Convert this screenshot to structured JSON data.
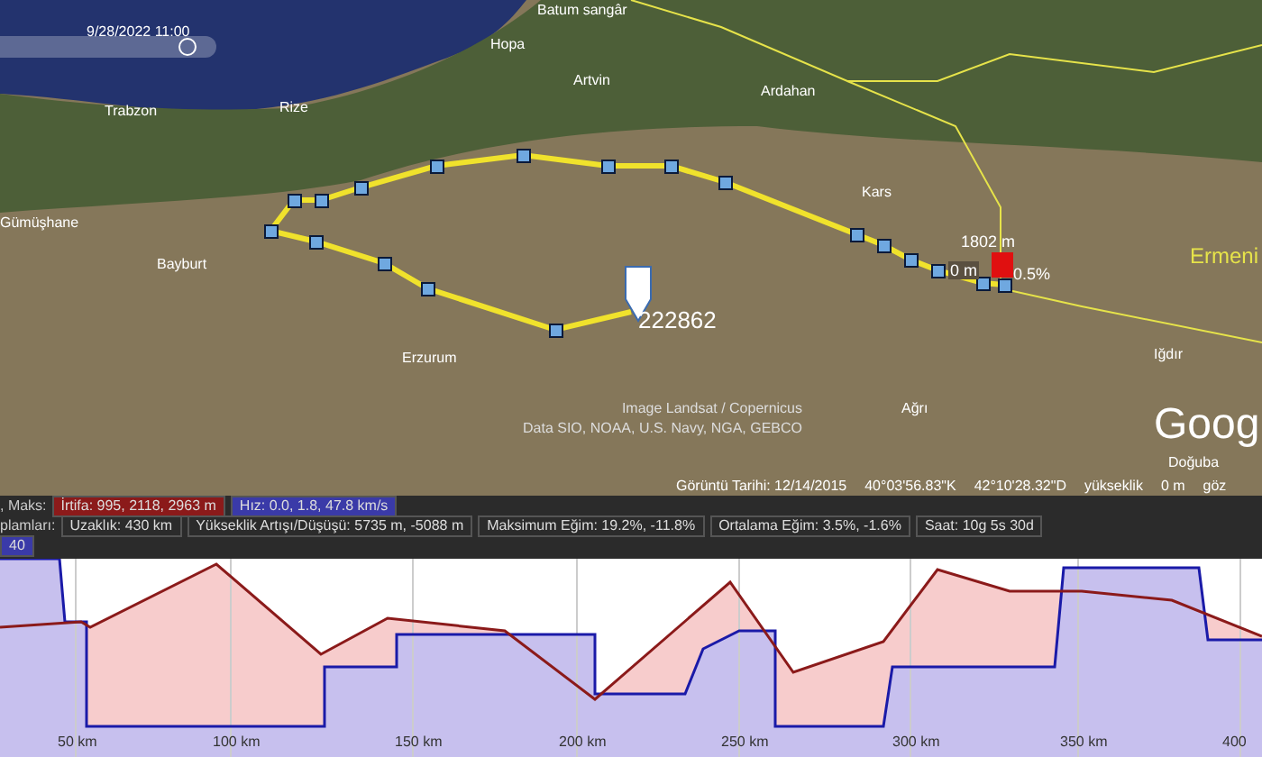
{
  "map": {
    "time_slider": {
      "label": "9/28/2022  11:00",
      "level": 0.9
    },
    "places": [
      {
        "name": "Batum sangâr"
      },
      {
        "name": "Hopa"
      },
      {
        "name": "Artvin"
      },
      {
        "name": "Trabzon"
      },
      {
        "name": "Rize"
      },
      {
        "name": "Ardahan"
      },
      {
        "name": "Kars"
      },
      {
        "name": "Gümüşhane"
      },
      {
        "name": "Bayburt"
      },
      {
        "name": "Erzurum"
      },
      {
        "name": "Iğdır"
      },
      {
        "name": "Ağrı"
      },
      {
        "name": "Doğuba"
      }
    ],
    "country": "Ermeni",
    "marker_label": "222862",
    "elevation_tag": "1802 m",
    "grade_tag": "0.5%",
    "small_tag": "0 m",
    "attribution": [
      "Image Landsat / Copernicus",
      "Data SIO, NOAA, U.S. Navy, NGA, GEBCO"
    ],
    "logo": "Goog",
    "status_bar": [
      "Görüntü Tarihi: 12/14/2015",
      "40°03'56.83\"K",
      "42°10'28.32\"D",
      "yükseklik",
      "0 m",
      "göz"
    ]
  },
  "stats": {
    "rows": [
      {
        "label": ", Maks:",
        "items": [
          {
            "text": "İrtifa: 995, 2118, 2963 m",
            "color": "#8b1a1a"
          },
          {
            "text": "Hız: 0.0, 1.8, 47.8 km/s",
            "color": "#3a3aa8"
          }
        ]
      },
      {
        "label": "plamları:",
        "items": [
          {
            "text": "Uzaklık: 430 km",
            "color": "#2b2b2b"
          },
          {
            "text": "Yükseklik Artışı/Düşüşü: 5735 m, -5088 m",
            "color": "#2b2b2b"
          },
          {
            "text": "Maksimum Eğim: 19.2%, -11.8%",
            "color": "#2b2b2b"
          },
          {
            "text": "Ortalama Eğim: 3.5%, -1.6%",
            "color": "#2b2b2b"
          },
          {
            "text": "Saat: 10g 5s 30d",
            "color": "#2b2b2b"
          }
        ]
      },
      {
        "label": "",
        "items": [
          {
            "text": "40",
            "color": "#3a3aa8"
          }
        ]
      }
    ]
  },
  "profile": {
    "x_labels": [
      "50 km",
      "100 km",
      "150 km",
      "200 km",
      "250 km",
      "300 km",
      "350 km",
      "400"
    ]
  }
}
